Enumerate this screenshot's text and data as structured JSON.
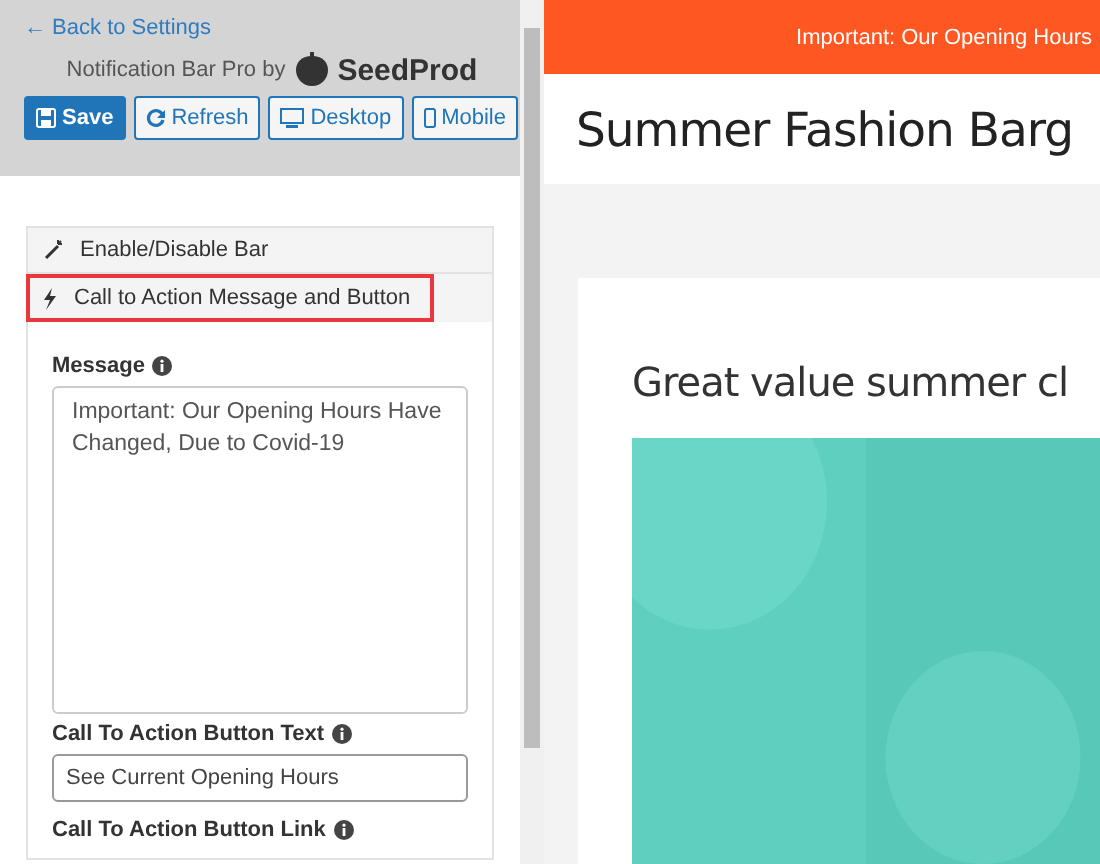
{
  "sidebar": {
    "back_link": "← Back to Settings",
    "brand_text": "Notification Bar Pro by",
    "brand_logo": "SeedProd",
    "buttons": [
      {
        "label": "Save",
        "kind": "primary"
      },
      {
        "label": "Refresh",
        "kind": "refresh"
      },
      {
        "label": "Desktop",
        "kind": "desktop"
      },
      {
        "label": "Mobile",
        "kind": "mobile"
      }
    ],
    "sections": [
      {
        "label": "Enable/Disable Bar",
        "kind": "wand",
        "highlighted": false
      },
      {
        "label": "Call to Action Message and Button",
        "kind": "bolt",
        "highlighted": true
      }
    ],
    "fields": [
      {
        "label": "Message",
        "kind": "textarea",
        "value": "Important: Our Opening Hours Have Changed, Due to Covid-19"
      },
      {
        "label": "Call To Action Button Text",
        "kind": "input",
        "value": "See Current Opening Hours"
      },
      {
        "label": "Call To Action Button Link",
        "kind": "label"
      }
    ]
  },
  "preview": {
    "notification": "Important: Our Opening Hours",
    "site_title": "Summer Fashion Barg",
    "headline": "Great value summer cl"
  }
}
